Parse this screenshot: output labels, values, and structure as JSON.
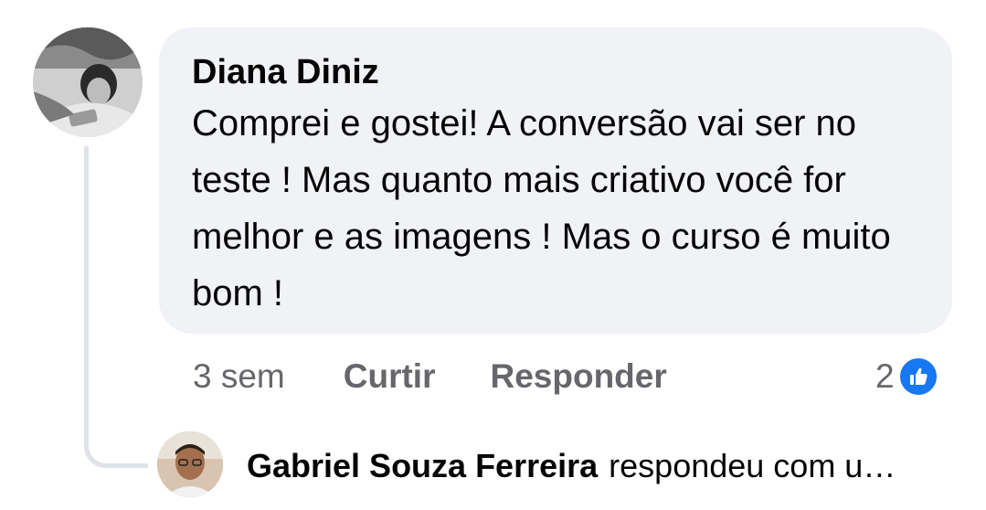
{
  "comment": {
    "author": "Diana Diniz",
    "text": "Comprei e gostei! A conversão vai ser no teste ! Mas quanto mais criativo você for melhor e as imagens ! Mas o curso é muito bom !",
    "time": "3 sem",
    "like_label": "Curtir",
    "reply_label": "Responder",
    "reaction_count": "2",
    "reaction_icon": "thumbs-up-icon",
    "reaction_color": "#1877f2"
  },
  "reply_preview": {
    "author": "Gabriel Souza Ferreira",
    "text": "respondeu com u…"
  }
}
